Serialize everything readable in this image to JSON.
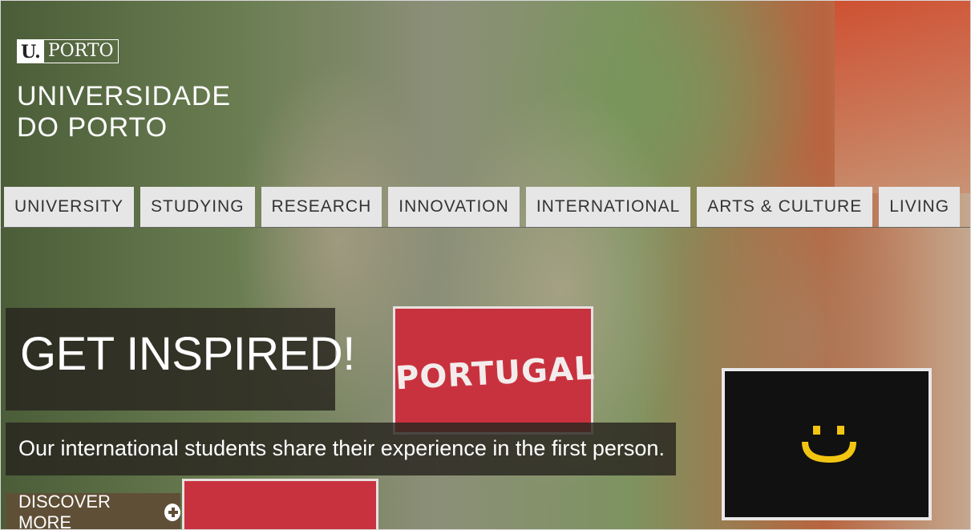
{
  "header": {
    "logo_u": "U.",
    "logo_porto": "PORTO",
    "university_line1": "UNIVERSIDADE",
    "university_line2": "DO PORTO"
  },
  "nav": {
    "items": [
      "UNIVERSITY",
      "STUDYING",
      "RESEARCH",
      "INNOVATION",
      "INTERNATIONAL",
      "ARTS & CULTURE",
      "LIVING"
    ]
  },
  "hero": {
    "headline": "GET INSPIRED!",
    "subheadline": "Our international students share their experience in the first person.",
    "cta_label": "DISCOVER MORE",
    "cta_icon": "plus-circle-icon",
    "sign_text": "PORTUGAL"
  },
  "colors": {
    "nav_bg": "#e6e6e6",
    "cta_bg": "#5f4f36",
    "overlay_bg": "#28241e"
  }
}
